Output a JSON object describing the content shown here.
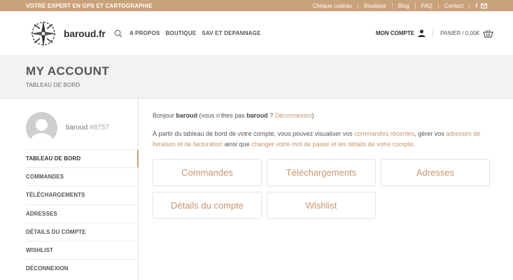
{
  "topbar": {
    "tagline": "VOTRE EXPERT EN GPS ET CARTOGRAPHIE",
    "links": [
      "Chèque cadeau",
      "Boutique",
      "Blog",
      "FAQ",
      "Contact"
    ],
    "social_icons": [
      "facebook-icon",
      "mail-icon"
    ]
  },
  "header": {
    "logo_text": "baroud.fr",
    "nav": [
      "A PROPOS",
      "BOUTIQUE",
      "SAV ET DEPANNAGE"
    ],
    "account_label": "MON COMPTE",
    "cart_label": "PANIER / 0,00€"
  },
  "page": {
    "title": "MY ACCOUNT",
    "breadcrumb": "TABLEAU DE BORD"
  },
  "user": {
    "name": "baroud",
    "id": "#8757"
  },
  "sidebar": {
    "items": [
      {
        "label": "TABLEAU DE BORD",
        "active": true
      },
      {
        "label": "COMMANDES"
      },
      {
        "label": "TÉLÉCHARGEMENTS"
      },
      {
        "label": "ADRESSES"
      },
      {
        "label": "DÉTAILS DU COMPTE"
      },
      {
        "label": "WISHLIST"
      },
      {
        "label": "DÉCONNEXION"
      }
    ]
  },
  "main": {
    "greeting": {
      "hello": "Bonjour ",
      "name": "baroud",
      "mid": " (vous n'êtes pas ",
      "name2": "baroud",
      "q": " ? ",
      "logout": "Déconnexion",
      "close": ")"
    },
    "intro": {
      "t1": "À partir du tableau de bord de votre compte, vous pouvez visualiser vos ",
      "l1": "commandes récentes",
      "t2": ", gérer vos ",
      "l2": "adresses de livraison et de facturation",
      "t3": " ainsi que ",
      "l3": "changer votre mot de passe et les détails de votre compte",
      "t4": "."
    },
    "tiles": [
      "Commandes",
      "Téléchargements",
      "Adresses",
      "Détails du compte",
      "Wishlist"
    ]
  },
  "colors": {
    "accent": "#c8a27a",
    "link": "#c8956a",
    "band": "#f2f2f2"
  }
}
